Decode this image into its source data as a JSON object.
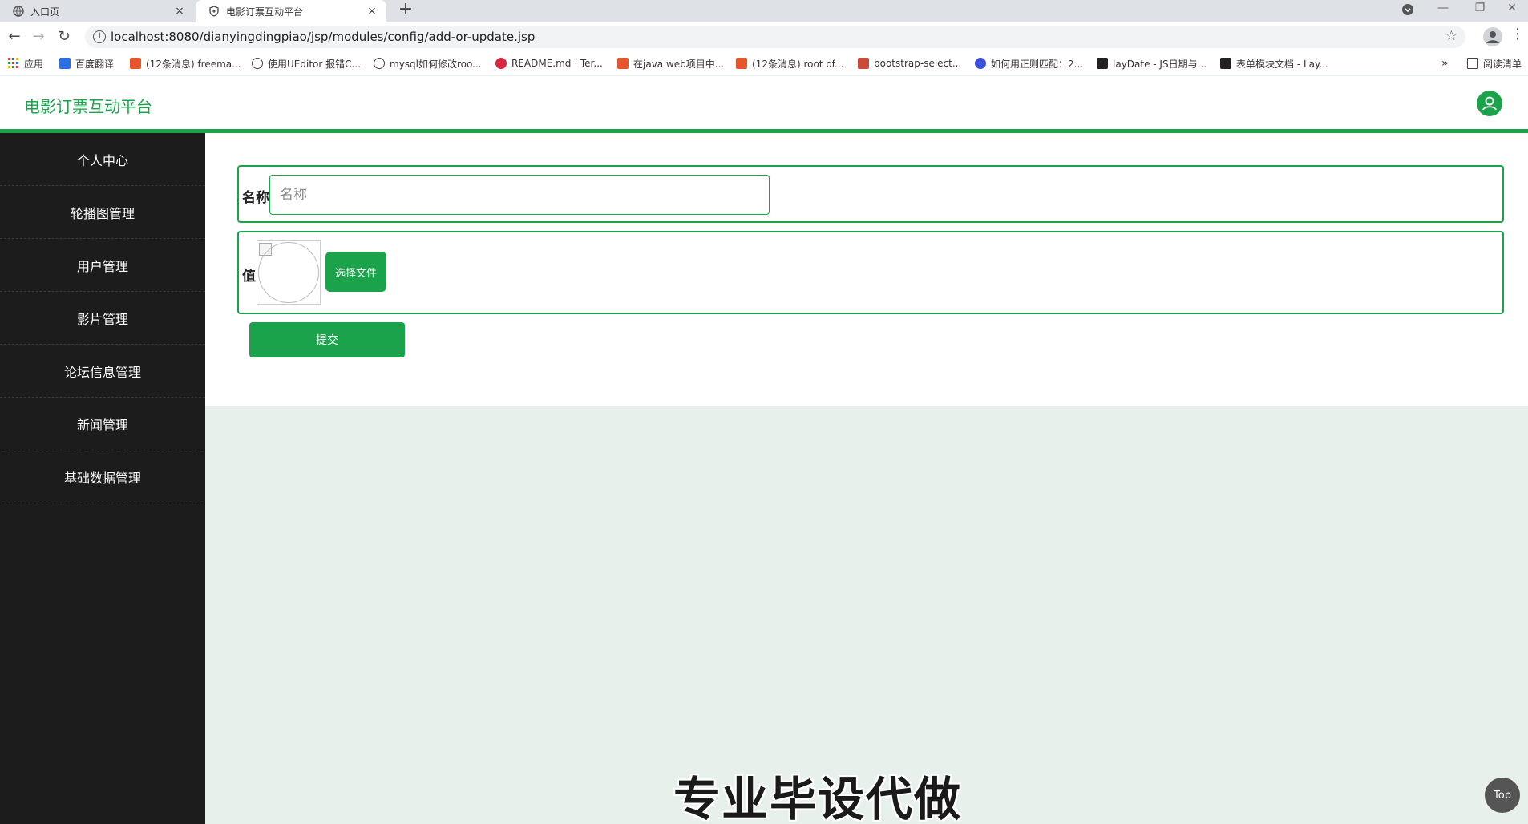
{
  "browser": {
    "tabs": [
      {
        "title": "入口页",
        "icon": "globe-icon"
      },
      {
        "title": "电影订票互动平台",
        "icon": "shield-icon"
      }
    ],
    "close_glyph": "×",
    "new_tab_glyph": "+",
    "url": "localhost:8080/dianyingdingpiao/jsp/modules/config/add-or-update.jsp",
    "info_glyph": "i",
    "star_glyph": "☆",
    "back_glyph": "←",
    "forward_glyph": "→",
    "reload_glyph": "↻",
    "minimize_glyph": "—",
    "restore_glyph": "❐",
    "close_window_glyph": "✕",
    "menu_glyph": "⋮",
    "bookmarks": [
      {
        "label": "应用",
        "color": "#e0473b"
      },
      {
        "label": "百度翻译",
        "color": "#2b6de5"
      },
      {
        "label": "(12条消息) freema...",
        "color": "#e4572e"
      },
      {
        "label": "使用UEditor 报错C...",
        "color": "#444444"
      },
      {
        "label": "mysql如何修改roo...",
        "color": "#444444"
      },
      {
        "label": "README.md · Ter...",
        "color": "#d7263d"
      },
      {
        "label": "在java web项目中...",
        "color": "#e4572e"
      },
      {
        "label": "(12条消息) root of...",
        "color": "#e4572e"
      },
      {
        "label": "bootstrap-select...",
        "color": "#c94c3b"
      },
      {
        "label": "如何用正则匹配：2...",
        "color": "#3b4fd8"
      },
      {
        "label": "layDate - JS日期与...",
        "color": "#222222"
      },
      {
        "label": "表单模块文档 - Lay...",
        "color": "#222222"
      }
    ],
    "more_bookmarks_glyph": "»",
    "reading_list": "阅读清单"
  },
  "app": {
    "brand": "电影订票互动平台",
    "accent_color": "#1aa34a"
  },
  "sidebar": {
    "items": [
      {
        "label": "个人中心"
      },
      {
        "label": "轮播图管理"
      },
      {
        "label": "用户管理"
      },
      {
        "label": "影片管理"
      },
      {
        "label": "论坛信息管理"
      },
      {
        "label": "新闻管理"
      },
      {
        "label": "基础数据管理"
      }
    ]
  },
  "form": {
    "name_label": "名称",
    "name_placeholder": "名称",
    "name_value": "",
    "value_label": "值",
    "choose_file_label": "选择文件",
    "submit_label": "提交"
  },
  "watermark": "专业毕设代做",
  "top_button": "Top"
}
